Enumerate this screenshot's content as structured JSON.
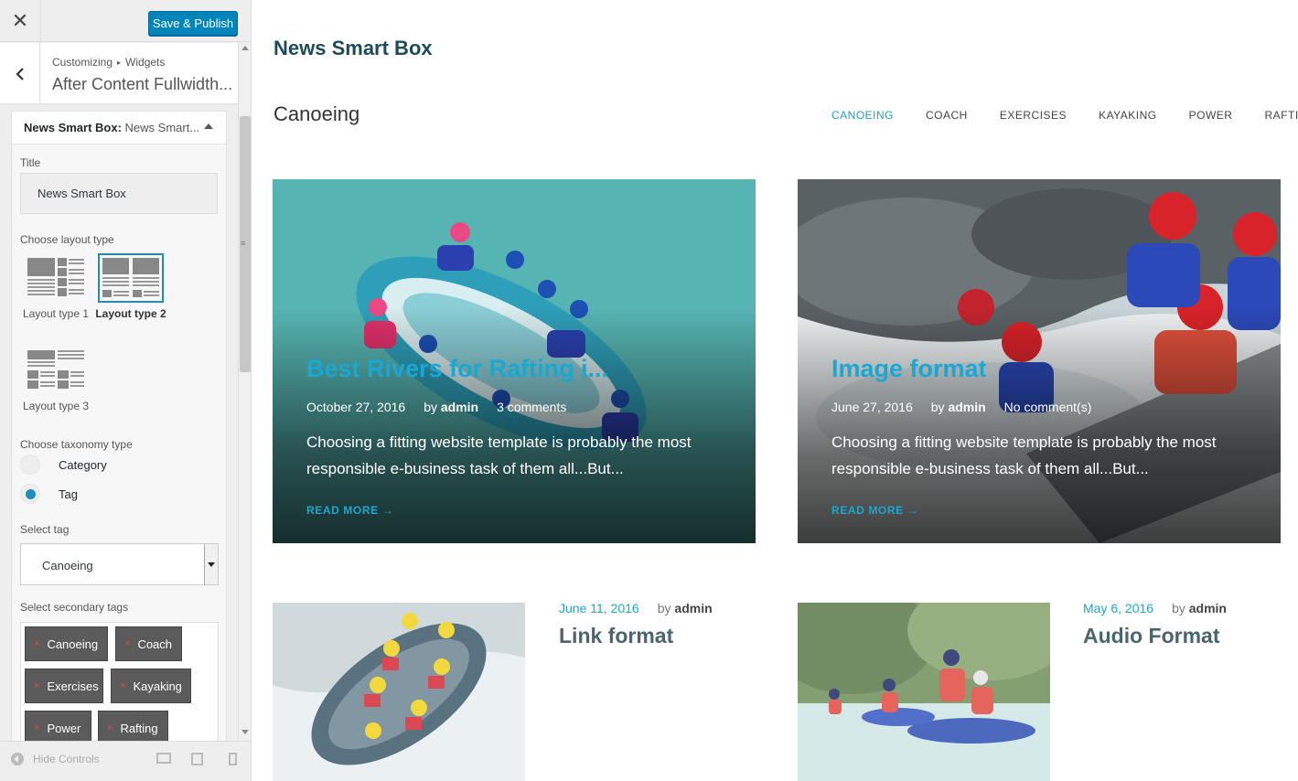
{
  "customizer": {
    "close_icon": "close-icon",
    "publish_label": "Save & Publish",
    "breadcrumb": [
      "Customizing",
      "Widgets"
    ],
    "section_title": "After Content Fullwidth...",
    "widget": {
      "name": "News Smart Box:",
      "subtitle": "News Smart...",
      "title_label": "Title",
      "title_value": "News Smart Box",
      "layout_label": "Choose layout type",
      "layouts": [
        {
          "label": "Layout type 1",
          "selected": false
        },
        {
          "label": "Layout type 2",
          "selected": true
        },
        {
          "label": "Layout type 3",
          "selected": false
        }
      ],
      "taxonomy_label": "Choose taxonomy type",
      "taxonomy_options": [
        {
          "label": "Category",
          "selected": false
        },
        {
          "label": "Tag",
          "selected": true
        }
      ],
      "select_tag_label": "Select tag",
      "select_tag_value": "Canoeing",
      "secondary_tags_label": "Select secondary tags",
      "secondary_tags": [
        "Canoeing",
        "Coach",
        "Exercises",
        "Kayaking",
        "Power",
        "Rafting"
      ],
      "remove_glyph": "×"
    },
    "footer": {
      "hide_controls_label": "Hide Controls"
    },
    "accent_color": "#0085ba"
  },
  "preview": {
    "widget_title": "News Smart Box",
    "tag_heading": "Canoeing",
    "tabs": [
      {
        "label": "CANOEING",
        "active": true
      },
      {
        "label": "COACH",
        "active": false
      },
      {
        "label": "EXERCISES",
        "active": false
      },
      {
        "label": "KAYAKING",
        "active": false
      },
      {
        "label": "POWER",
        "active": false
      },
      {
        "label": "RAFTING",
        "active": false
      }
    ],
    "featured_posts": [
      {
        "title": "Best Rivers for Rafting i...",
        "date": "October 27, 2016",
        "by": "by",
        "author": "admin",
        "comments": "3 comments",
        "excerpt": "Choosing a fitting website template is probably the most responsible e-business task of them all...But...",
        "read_more": "READ MORE →"
      },
      {
        "title": "Image format",
        "date": "June 27, 2016",
        "by": "by",
        "author": "admin",
        "comments": "No comment(s)",
        "excerpt": "Choosing a fitting website template is probably the most responsible e-business task of them all...But...",
        "read_more": "READ MORE →"
      }
    ],
    "small_posts": [
      {
        "date": "June 11, 2016",
        "by": "by",
        "author": "admin",
        "title": "Link format"
      },
      {
        "date": "May 6, 2016",
        "by": "by",
        "author": "admin",
        "title": "Audio Format"
      }
    ],
    "accent_color": "#19a7d3"
  }
}
